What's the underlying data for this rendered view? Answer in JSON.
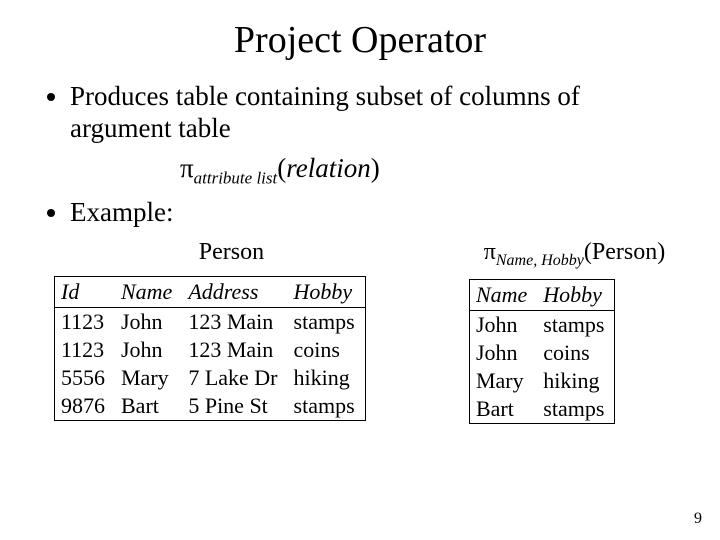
{
  "title": "Project Operator",
  "bullet1": "Produces table containing subset of columns of argument table",
  "formula": {
    "pi": "π",
    "sub": "attribute list",
    "open": "(",
    "rel": "relation",
    "close": ")"
  },
  "bullet2": "Example:",
  "left": {
    "title": "Person",
    "headers": {
      "c1": "Id",
      "c2": "Name",
      "c3": "Address",
      "c4": "Hobby"
    },
    "rows": [
      {
        "c1": "1123",
        "c2": "John",
        "c3": "123 Main",
        "c4": "stamps"
      },
      {
        "c1": "1123",
        "c2": "John",
        "c3": "123 Main",
        "c4": "coins"
      },
      {
        "c1": "5556",
        "c2": "Mary",
        "c3": "7 Lake Dr",
        "c4": "hiking"
      },
      {
        "c1": "9876",
        "c2": "Bart",
        "c3": "5 Pine St",
        "c4": "stamps"
      }
    ]
  },
  "right": {
    "title": {
      "pi": "π",
      "sub": "Name, Hobby",
      "open": "(",
      "rel": "Person",
      "close": ")"
    },
    "headers": {
      "c1": "Name",
      "c2": "Hobby"
    },
    "rows": [
      {
        "c1": "John",
        "c2": "stamps"
      },
      {
        "c1": "John",
        "c2": "coins"
      },
      {
        "c1": "Mary",
        "c2": "hiking"
      },
      {
        "c1": "Bart",
        "c2": "stamps"
      }
    ]
  },
  "page": "9"
}
